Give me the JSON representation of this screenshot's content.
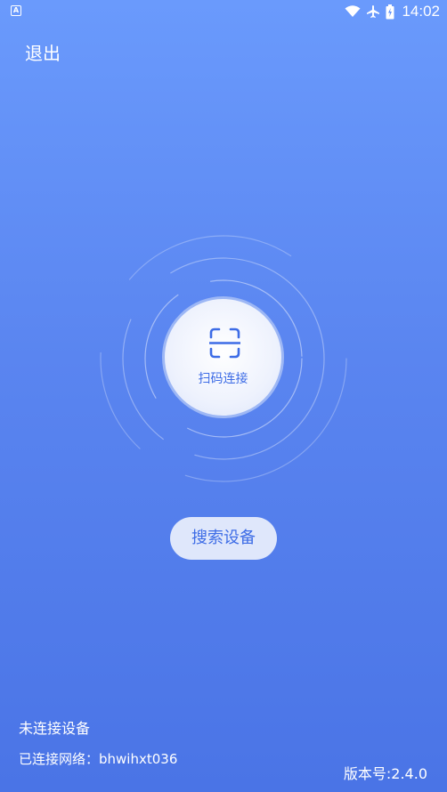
{
  "status_bar": {
    "app_indicator": "A",
    "time": "14:02",
    "icons": [
      "wifi-icon",
      "airplane-icon",
      "battery-icon"
    ]
  },
  "header": {
    "exit_label": "退出"
  },
  "scan": {
    "label": "扫码连接",
    "icon": "scan-frame-icon"
  },
  "search": {
    "label": "搜索设备"
  },
  "footer": {
    "connection_status": "未连接设备",
    "network_label": "已连接网络：",
    "network_name": "bhwihxt036",
    "version_label": "版本号:",
    "version_value": "2.4.0"
  },
  "colors": {
    "background_top": "#6a9afc",
    "background_bottom": "#4a74e6",
    "accent": "#3d6ce6",
    "button_bg": "#dfe7fb"
  }
}
